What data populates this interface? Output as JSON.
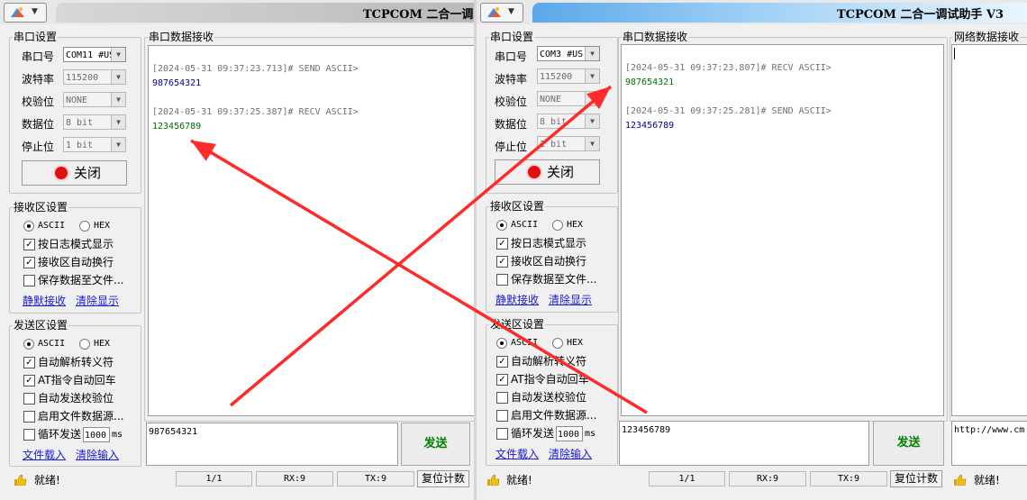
{
  "left_window": {
    "title": "TCPCOM 二合一调",
    "serial_settings": {
      "title": "串口设置",
      "port_label": "串口号",
      "port_value": "COM11 #US",
      "baud_label": "波特率",
      "baud_value": "115200",
      "parity_label": "校验位",
      "parity_value": "NONE",
      "databits_label": "数据位",
      "databits_value": "8 bit",
      "stopbits_label": "停止位",
      "stopbits_value": "1 bit",
      "close_button": "关闭"
    },
    "recv_settings": {
      "title": "接收区设置",
      "ascii": "ASCII",
      "hex": "HEX",
      "log_mode": "按日志模式显示",
      "auto_wrap": "接收区自动换行",
      "save_file": "保存数据至文件...",
      "silent_recv": "静默接收",
      "clear_display": "清除显示"
    },
    "send_settings": {
      "title": "发送区设置",
      "ascii": "ASCII",
      "hex": "HEX",
      "auto_escape": "自动解析转义符",
      "at_cr": "AT指令自动回车",
      "auto_checksum": "自动发送校验位",
      "file_source": "启用文件数据源...",
      "loop_send": "循环发送",
      "loop_ms": "1000",
      "ms": "ms",
      "file_load": "文件载入",
      "clear_input": "清除输入"
    },
    "recv_area": {
      "title": "串口数据接收",
      "lines": [
        {
          "ts": "[2024-05-31 09:37:23.713]# SEND ASCII>",
          "data": "987654321",
          "color": "#000090"
        },
        {
          "ts": "[2024-05-31 09:37:25.387]# RECV ASCII>",
          "data": "123456789",
          "color": "#007000"
        }
      ]
    },
    "send_input": "987654321",
    "send_button": "发送",
    "status": {
      "text": "就绪!",
      "page": "1/1",
      "rx": "RX:9",
      "tx": "TX:9",
      "reset": "复位计数"
    }
  },
  "right_window": {
    "title": "TCPCOM  二合一调试助手  V3",
    "serial_settings": {
      "title": "串口设置",
      "port_label": "串口号",
      "port_value": "COM3 #US",
      "baud_label": "波特率",
      "baud_value": "115200",
      "parity_label": "校验位",
      "parity_value": "NONE",
      "databits_label": "数据位",
      "databits_value": "8 bit",
      "stopbits_label": "停止位",
      "stopbits_value": "1 bit",
      "close_button": "关闭"
    },
    "recv_settings": {
      "title": "接收区设置",
      "ascii": "ASCII",
      "hex": "HEX",
      "log_mode": "按日志模式显示",
      "auto_wrap": "接收区自动换行",
      "save_file": "保存数据至文件...",
      "silent_recv": "静默接收",
      "clear_display": "清除显示"
    },
    "send_settings": {
      "title": "发送区设置",
      "ascii": "ASCII",
      "hex": "HEX",
      "auto_escape": "自动解析转义符",
      "at_cr": "AT指令自动回车",
      "auto_checksum": "自动发送校验位",
      "file_source": "启用文件数据源...",
      "loop_send": "循环发送",
      "loop_ms": "1000",
      "ms": "ms",
      "file_load": "文件载入",
      "clear_input": "清除输入"
    },
    "recv_area": {
      "title": "串口数据接收",
      "lines": [
        {
          "ts": "[2024-05-31 09:37:23.807]# RECV ASCII>",
          "data": "987654321",
          "color": "#007000"
        },
        {
          "ts": "[2024-05-31 09:37:25.281]# SEND ASCII>",
          "data": "123456789",
          "color": "#000090"
        }
      ]
    },
    "net_area": {
      "title": "网络数据接收",
      "url": "http://www.cm"
    },
    "send_input": "123456789",
    "send_button": "发送",
    "status": {
      "text": "就绪!",
      "page": "1/1",
      "rx": "RX:9",
      "tx": "TX:9",
      "reset": "复位计数",
      "text2": "就绪!"
    }
  },
  "annotation_color": "#ff2a2a"
}
